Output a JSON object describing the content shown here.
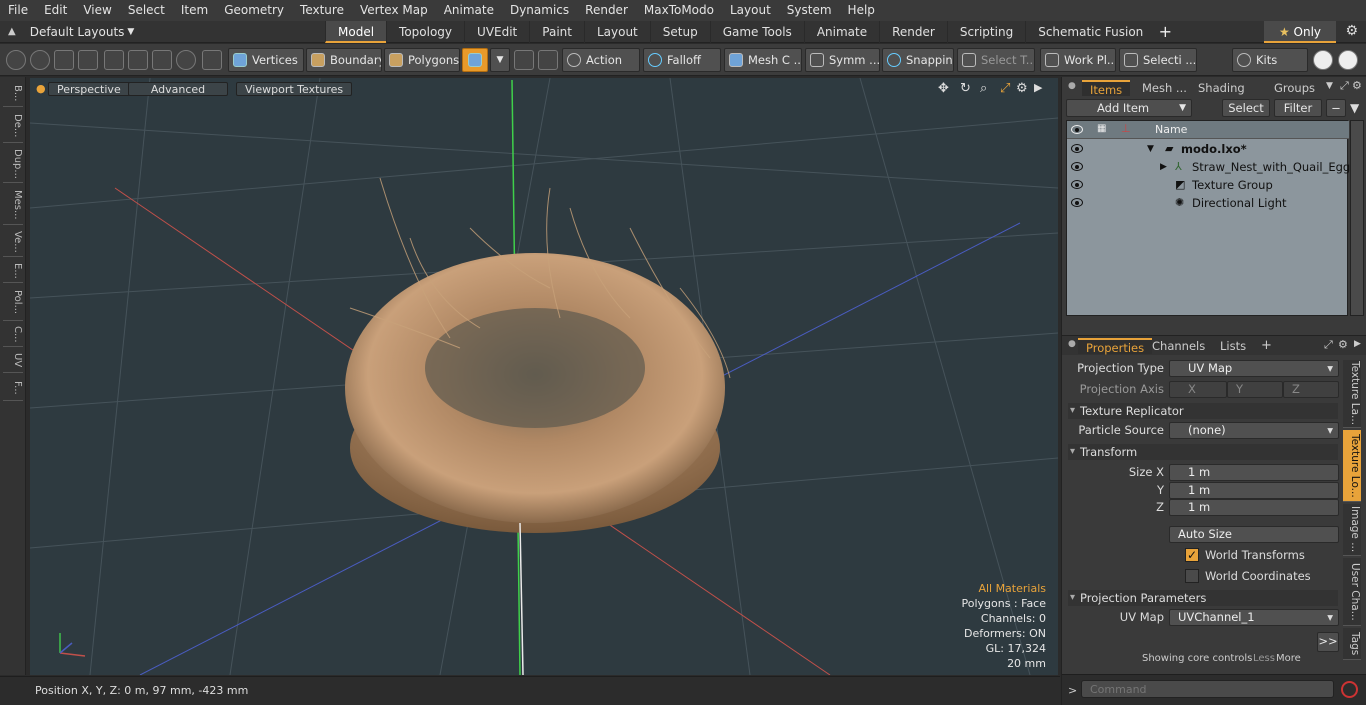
{
  "menu": [
    "File",
    "Edit",
    "View",
    "Select",
    "Item",
    "Geometry",
    "Texture",
    "Vertex Map",
    "Animate",
    "Dynamics",
    "Render",
    "MaxToModo",
    "Layout",
    "System",
    "Help"
  ],
  "layouts": {
    "label": "Default Layouts"
  },
  "tabs": [
    "Model",
    "Topology",
    "UVEdit",
    "Paint",
    "Layout",
    "Setup",
    "Game Tools",
    "Animate",
    "Render",
    "Scripting",
    "Schematic Fusion"
  ],
  "only_label": "Only",
  "toolbar": {
    "vertices": "Vertices",
    "boundary": "Boundary",
    "polygons": "Polygons",
    "action": "Action",
    "falloff": "Falloff",
    "mesh": "Mesh C ...",
    "symm": "Symm ...",
    "snapping": "Snapping",
    "select_t": "Select T...",
    "work_pl": "Work Pl...",
    "selecti": "Selecti ...",
    "kits": "Kits"
  },
  "left_tabs": [
    "B...",
    "De...",
    "Dup...",
    "Mes...",
    "Ve...",
    "E...",
    "Pol...",
    "C...",
    "UV",
    "F..."
  ],
  "viewport": {
    "perspective": "Perspective",
    "advanced": "Advanced",
    "textures": "Viewport Textures",
    "info": {
      "all_materials": "All Materials",
      "polygons": "Polygons : Face",
      "channels": "Channels: 0",
      "deformers": "Deformers: ON",
      "gl": "GL: 17,324",
      "scale": "20 mm"
    }
  },
  "status": {
    "position": "Position X, Y, Z:   0 m, 97 mm, -423 mm"
  },
  "items_panel": {
    "tabs": [
      "Items",
      "Mesh ...",
      "Shading",
      "Groups"
    ],
    "add_item": "Add Item",
    "select": "Select",
    "filter": "Filter",
    "name_header": "Name",
    "rows": [
      "modo.lxo*",
      "Straw_Nest_with_Quail_Eggs",
      "Texture Group",
      "Directional Light"
    ]
  },
  "props_panel": {
    "tabs": [
      "Properties",
      "Channels",
      "Lists"
    ],
    "projection_type_label": "Projection Type",
    "projection_type": "UV Map",
    "projection_axis_label": "Projection Axis",
    "axis_x": "X",
    "axis_y": "Y",
    "axis_z": "Z",
    "texture_replicator": "Texture Replicator",
    "particle_source_label": "Particle Source",
    "particle_source": "(none)",
    "transform": "Transform",
    "size_x_label": "Size X",
    "y_label": "Y",
    "z_label": "Z",
    "size_x": "1 m",
    "size_y": "1 m",
    "size_z": "1 m",
    "auto_size": "Auto Size",
    "world_transforms": "World Transforms",
    "world_coordinates": "World Coordinates",
    "projection_parameters": "Projection Parameters",
    "uv_map_label": "UV Map",
    "uv_map": "UVChannel_1",
    "more_btn": ">>",
    "showing": "Showing core controls",
    "less": "Less",
    "more": "More"
  },
  "right_vtabs": [
    "Texture La...",
    "Texture Lo...",
    "Image ...",
    "User Cha...",
    "Tags"
  ],
  "command": {
    "placeholder": "Command"
  }
}
